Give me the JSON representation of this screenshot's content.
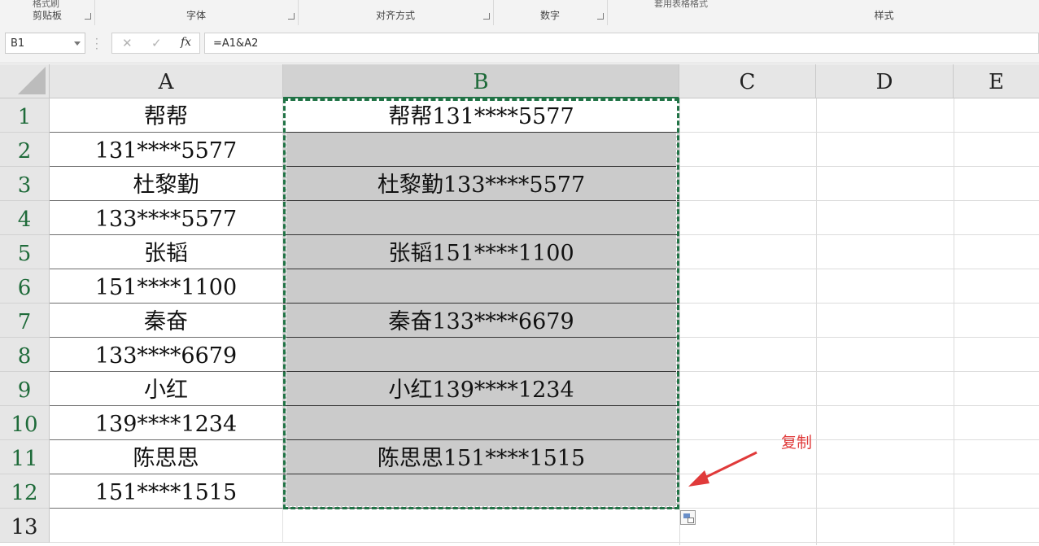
{
  "ribbon": {
    "groups": [
      "剪贴板",
      "字体",
      "对齐方式",
      "数字",
      "样式"
    ],
    "partial_top_left": "格式刷",
    "partial_top_mid": "套用表格格式"
  },
  "formula_bar": {
    "name_box": "B1",
    "cancel_symbol": "✕",
    "enter_symbol": "✓",
    "fx_symbol": "fx",
    "formula": "=A1&A2"
  },
  "columns": [
    "A",
    "B",
    "C",
    "D",
    "E"
  ],
  "selected_column": "B",
  "rows": [
    {
      "num": "1",
      "a": "帮帮",
      "b": "帮帮131****5577"
    },
    {
      "num": "2",
      "a": "131****5577",
      "b": ""
    },
    {
      "num": "3",
      "a": "杜黎勤",
      "b": "杜黎勤133****5577"
    },
    {
      "num": "4",
      "a": "133****5577",
      "b": ""
    },
    {
      "num": "5",
      "a": "张韬",
      "b": "张韬151****1100"
    },
    {
      "num": "6",
      "a": "151****1100",
      "b": ""
    },
    {
      "num": "7",
      "a": "秦奋",
      "b": "秦奋133****6679"
    },
    {
      "num": "8",
      "a": "133****6679",
      "b": ""
    },
    {
      "num": "9",
      "a": "小红",
      "b": "小红139****1234"
    },
    {
      "num": "10",
      "a": "139****1234",
      "b": ""
    },
    {
      "num": "11",
      "a": "陈思思",
      "b": "陈思思151****1515"
    },
    {
      "num": "12",
      "a": "151****1515",
      "b": ""
    },
    {
      "num": "13",
      "a": "",
      "b": ""
    }
  ],
  "annotation": {
    "text": "复制",
    "color": "#e03a3a"
  },
  "colors": {
    "accent": "#217346",
    "selection_fill": "#cbcbcb"
  }
}
